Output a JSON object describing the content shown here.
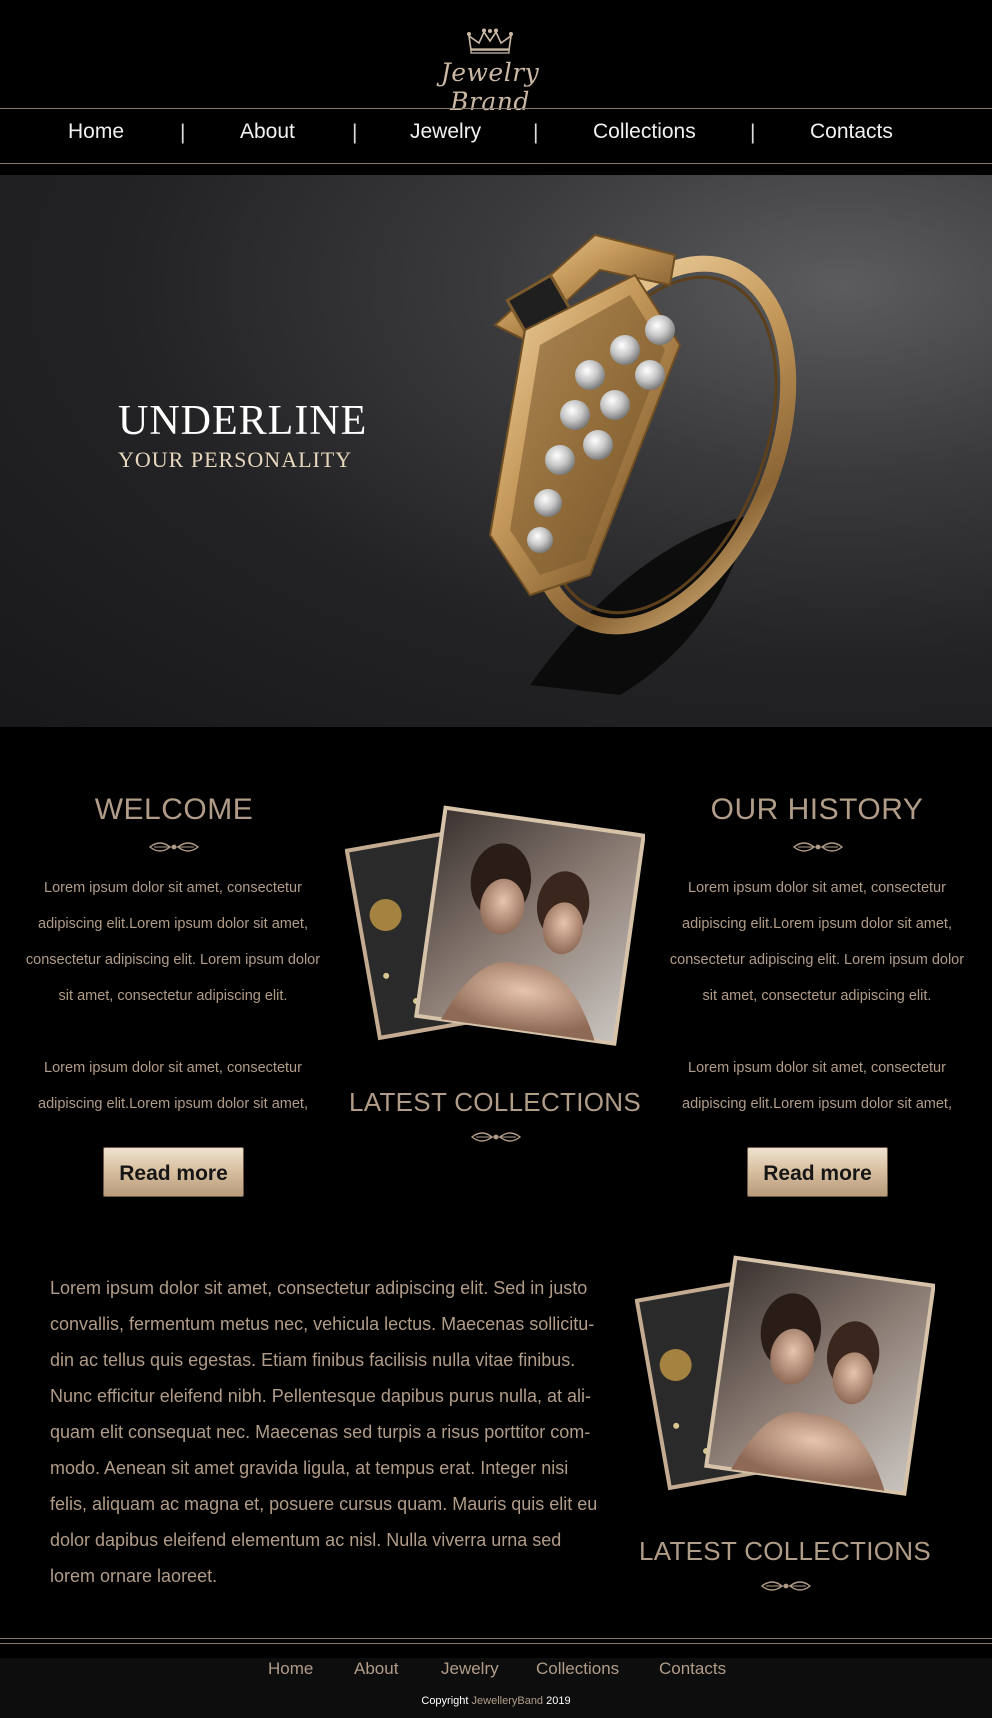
{
  "brand": {
    "logo_text": "Jewelry Brand",
    "icon": "crown-icon"
  },
  "nav": {
    "items": [
      "Home",
      "About",
      "Jewelry",
      "Collections",
      "Contacts"
    ],
    "separator": "|"
  },
  "hero": {
    "title": "UNDERLINE",
    "subtitle": "YOUR PERSONALITY",
    "image": "gold-ring-image"
  },
  "welcome": {
    "title": "WELCOME",
    "paragraph1": "Lorem ipsum dolor sit amet, consectetur adipiscing elit.Lorem ipsum dolor sit amet, consectetur adipiscing elit. Lorem ipsum dolor sit amet, consectetur adipiscing elit.",
    "paragraph2": "Lorem ipsum dolor sit amet, consectetur adipiscing elit.Lorem ipsum dolor sit amet,",
    "button": "Read more"
  },
  "history": {
    "title": "OUR HISTORY",
    "paragraph1": "Lorem ipsum dolor sit amet, consectetur adipiscing elit.Lorem ipsum dolor sit amet, consectetur adipiscing elit. Lorem ipsum dolor sit amet, consectetur adipiscing elit.",
    "paragraph2": "Lorem ipsum dolor sit amet, consectetur adipiscing elit.Lorem ipsum dolor sit amet,",
    "button": "Read more"
  },
  "latest_collections": {
    "title": "LATEST COLLECTIONS",
    "image": "models-photo-stack"
  },
  "body_text": "Lorem ipsum dolor sit amet, consectetur adipiscing elit. Sed in justo convallis, fermentum metus nec, vehicula lectus. Maecenas sollicitu-din ac tellus quis egestas. Etiam finibus facilisis nulla vitae finibus. Nunc efficitur eleifend nibh. Pellentesque dapibus purus nulla, at ali-quam elit consequat nec. Maecenas sed turpis a risus porttitor com-modo. Aenean sit amet gravida ligula, at tempus erat. Integer nisi felis, aliquam ac magna et, posuere cursus quam. Mauris quis elit eu dolor dapibus eleifend elementum ac nisl. Nulla viverra urna sed lorem ornare laoreet.",
  "footer": {
    "items": [
      "Home",
      "About",
      "Jewelry",
      "Collections",
      "Contacts"
    ],
    "copyright_prefix": "Copyright",
    "copyright_brand": "JewelleryBand",
    "copyright_year": "2019"
  },
  "colors": {
    "accent": "#b19c88",
    "background": "#000000",
    "button_gradient_top": "#efe2cf",
    "button_gradient_bottom": "#b79b7b"
  }
}
